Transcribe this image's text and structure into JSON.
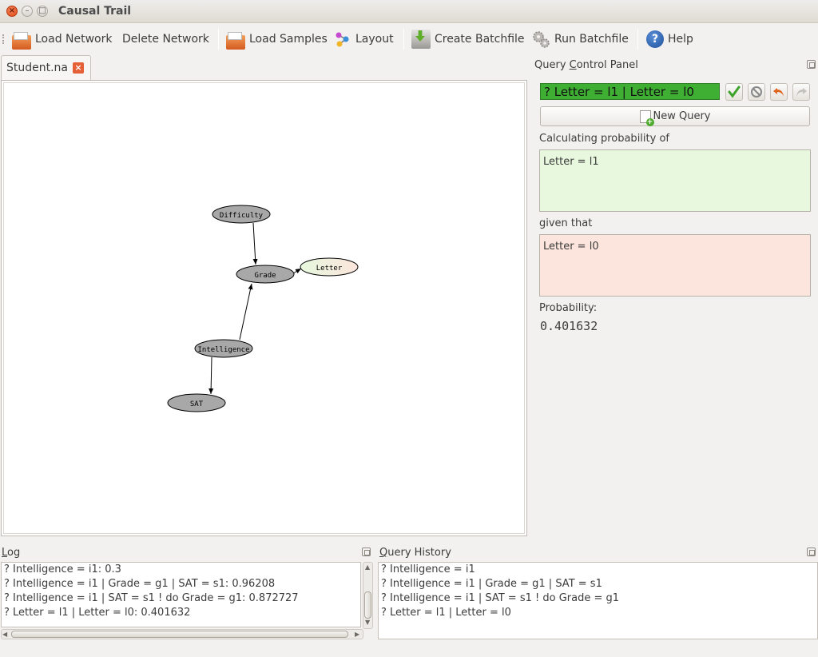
{
  "window": {
    "title": "Causal Trail"
  },
  "toolbar": {
    "load_network": "Load Network",
    "delete_network": "Delete Network",
    "load_samples": "Load Samples",
    "layout": "Layout",
    "create_batchfile": "Create Batchfile",
    "run_batchfile": "Run Batchfile",
    "help": "Help"
  },
  "tab": {
    "label": "Student.na"
  },
  "graph": {
    "nodes": [
      {
        "id": "difficulty",
        "label": "Difficulty",
        "state": "default"
      },
      {
        "id": "grade",
        "label": "Grade",
        "state": "default"
      },
      {
        "id": "letter",
        "label": "Letter",
        "state": "query-and-evidence"
      },
      {
        "id": "intelligence",
        "label": "Intelligence",
        "state": "default"
      },
      {
        "id": "sat",
        "label": "SAT",
        "state": "default"
      }
    ],
    "edges": [
      {
        "from": "difficulty",
        "to": "grade"
      },
      {
        "from": "grade",
        "to": "letter"
      },
      {
        "from": "intelligence",
        "to": "grade"
      },
      {
        "from": "intelligence",
        "to": "sat"
      }
    ],
    "colors": {
      "node": "#a8a8a8",
      "letter_left": "#e7f8de",
      "letter_right": "#fbe5dc"
    }
  },
  "query_panel": {
    "title_prefix": "Query ",
    "title_underlined": "C",
    "title_suffix": "ontrol Panel",
    "query_text": "? Letter = l1 | Letter = l0",
    "new_query": "New Query",
    "calc_label": "Calculating probability of",
    "query_vars": "Letter = l1",
    "given_label": "given that",
    "evidence": "Letter = l0",
    "probability_label": "Probability:",
    "probability_value": "0.401632",
    "colors": {
      "query_ok": "#3faf34",
      "query_box": "#e7f8de",
      "evidence_box": "#fbe5dc"
    }
  },
  "log": {
    "title_underlined": "L",
    "title_suffix": "og",
    "lines": [
      "? Intelligence = i1: 0.3",
      "? Intelligence = i1 | Grade = g1 | SAT = s1: 0.96208",
      "? Intelligence = i1 | SAT = s1 ! do Grade = g1: 0.872727",
      "? Letter = l1 | Letter = l0: 0.401632"
    ]
  },
  "history": {
    "title_underlined": "Q",
    "title_suffix": "uery History",
    "lines": [
      "? Intelligence = i1",
      "? Intelligence = i1 | Grade = g1 | SAT = s1",
      "? Intelligence = i1 | SAT = s1 ! do Grade = g1",
      "? Letter = l1 | Letter = l0"
    ]
  }
}
